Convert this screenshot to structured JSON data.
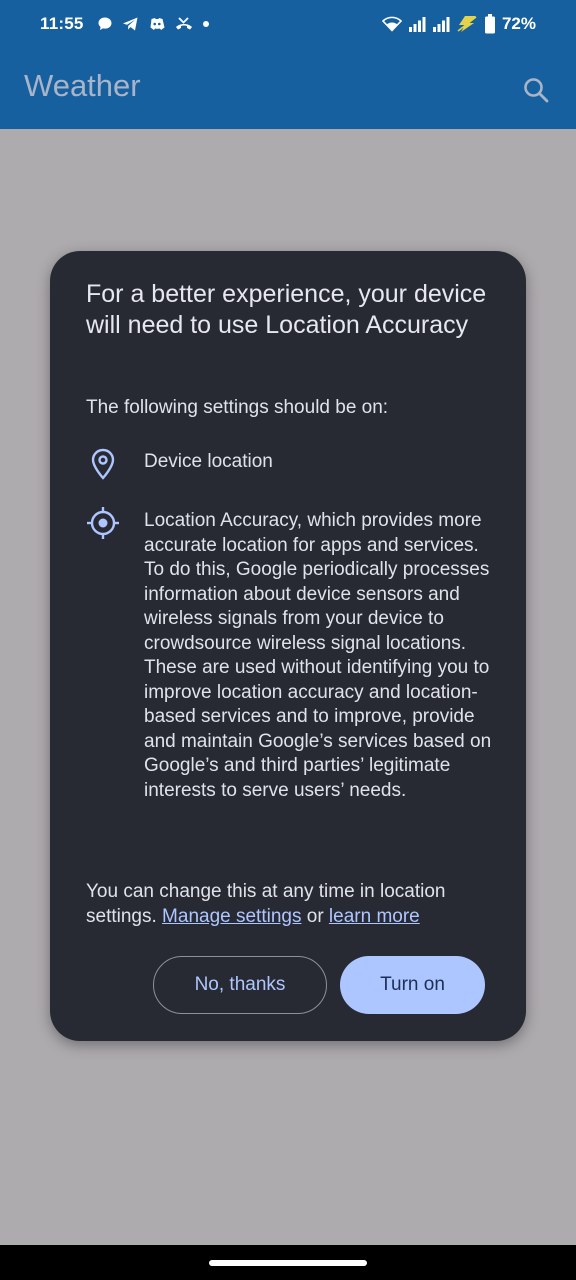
{
  "status_bar": {
    "time": "11:55",
    "battery": "72%",
    "left_icons": [
      "chat-bubble-icon",
      "telegram-icon",
      "discord-icon",
      "missed-call-icon",
      "dot-icon"
    ],
    "right_icons": [
      "wifi-icon",
      "signal-icon",
      "signal-icon",
      "flash-icon",
      "battery-icon"
    ]
  },
  "app_bar": {
    "title": "Weather",
    "search_icon": "search-icon"
  },
  "dialog": {
    "title": "For a better experience, your device will need to use Location Accuracy",
    "subtitle": "The following settings should be on:",
    "items": [
      {
        "icon": "location-pin-icon",
        "text": "Device location"
      },
      {
        "icon": "location-target-icon",
        "text": "Location Accuracy, which provides more accurate location for apps and services. To do this, Google periodically processes information about device sensors and wireless signals from your device to crowdsource wireless signal locations. These are used without identifying you to improve location accuracy and location-based services and to improve, provide and maintain Google’s services based on Google’s and third parties’ legitimate interests to serve users’ needs."
      }
    ],
    "footer_prefix": "You can change this at any time in location settings. ",
    "manage_link": "Manage settings",
    "footer_or": " or ",
    "learn_link": "learn more",
    "buttons": {
      "decline": "No, thanks",
      "accept": "Turn on"
    }
  },
  "colors": {
    "app_bar": "#17609f",
    "scrim": "#aeabaf",
    "dialog_bg": "#272a33",
    "accent": "#aec6ff"
  }
}
